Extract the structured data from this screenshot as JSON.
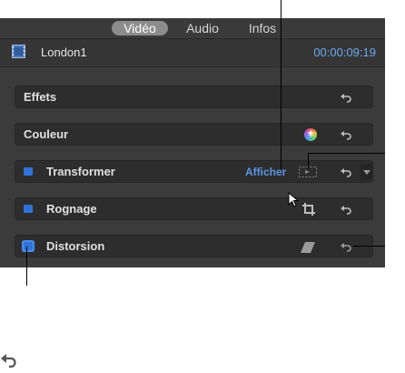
{
  "tabs": [
    {
      "label": "Vidéo",
      "active": true
    },
    {
      "label": "Audio",
      "active": false
    },
    {
      "label": "Infos",
      "active": false
    }
  ],
  "header": {
    "clip_icon": "film-icon",
    "clip_name": "London1",
    "timecode": "00:00:09:19"
  },
  "rows": {
    "effects": {
      "label": "Effets"
    },
    "color": {
      "label": "Couleur",
      "icon": "color-board-icon"
    },
    "transform": {
      "label": "Transformer",
      "show_label": "Afficher",
      "enabled": true
    },
    "crop": {
      "label": "Rognage",
      "icon": "crop-icon",
      "enabled": true
    },
    "distort": {
      "label": "Distorsion",
      "icon": "distort-icon",
      "enabled": true
    }
  },
  "colors": {
    "accent_blue": "#2f73d8",
    "timecode_blue": "#6ea8ee",
    "panel": "#3b3b3b"
  }
}
